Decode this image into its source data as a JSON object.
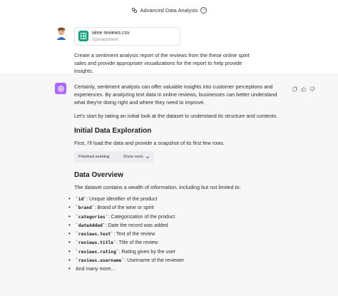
{
  "header": {
    "title": "Advanced Data Analysis"
  },
  "user_message": {
    "file": {
      "name": "wine reviews.csv",
      "type": "Spreadsheet"
    },
    "text": "Create a sentiment analysis report of the reviews from the these online spirit sales and provide appropriate visualizations for the report to help provide insights."
  },
  "assistant_message": {
    "intro": "Certainly, sentiment analysis can offer valuable insights into customer perceptions and experiences. By analyzing text data in online reviews, businesses can better understand what they're doing right and where they need to improve.",
    "start": "Let's start by taking an initial look at the dataset to understand its structure and contents.",
    "section1_title": "Initial Data Exploration",
    "section1_text": "First, I'll load the data and provide a snapshot of its first few rows.",
    "working": {
      "status": "Finished working",
      "toggle": "Show work"
    },
    "section2_title": "Data Overview",
    "section2_text": "The dataset contains a wealth of information, including but not limited to:",
    "fields": [
      {
        "key": "`id`",
        "desc": ": Unique identifier of the product"
      },
      {
        "key": "`brand`",
        "desc": ": Brand of the wine or spirit"
      },
      {
        "key": "`categories`",
        "desc": ": Categorization of the product"
      },
      {
        "key": "`dateAdded`",
        "desc": ": Date the record was added"
      },
      {
        "key": "`reviews.text`",
        "desc": ": Text of the review"
      },
      {
        "key": "`reviews.title`",
        "desc": ": Title of the review"
      },
      {
        "key": "`reviews.rating`",
        "desc": ": Rating given by the user"
      },
      {
        "key": "`reviews.username`",
        "desc": ": Username of the reviewer"
      },
      {
        "key": "",
        "desc": "And many more..."
      }
    ]
  },
  "icons": {
    "mode": "sparkle-icon",
    "info": "info-icon",
    "file": "spreadsheet-icon",
    "assistant": "openai-logo-icon",
    "copy": "copy-icon",
    "like": "thumbs-up-icon",
    "dislike": "thumbs-down-icon",
    "chevron": "chevron-down-icon"
  },
  "colors": {
    "accent": "#10a37f",
    "assistant_avatar": "#ab68ff",
    "assistant_bg": "#f7f7f8"
  }
}
